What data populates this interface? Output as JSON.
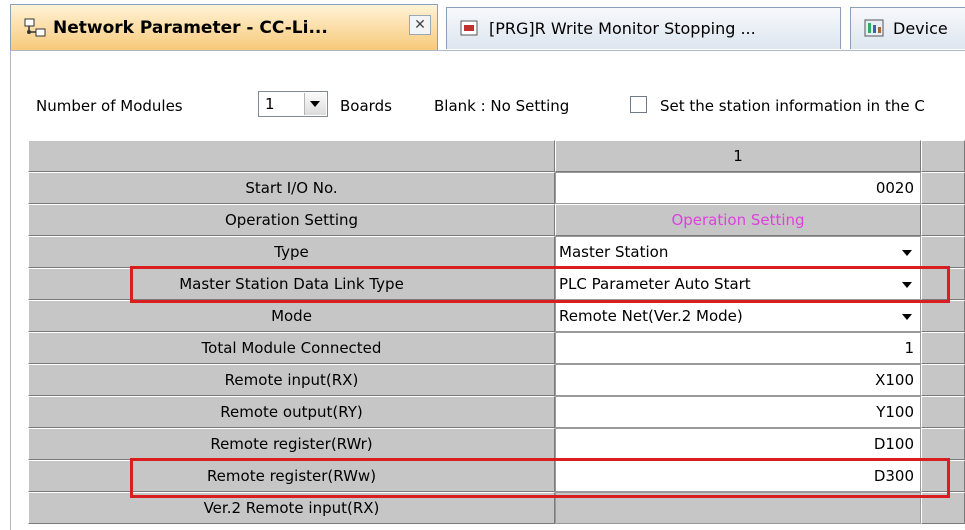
{
  "tabs": [
    {
      "label": "Network Parameter - CC-Li...",
      "icon": "network-parameter-icon",
      "active": true,
      "close": "✕"
    },
    {
      "label": "[PRG]R Write Monitor Stopping ...",
      "icon": "program-icon"
    },
    {
      "label": "Device",
      "icon": "device-icon"
    }
  ],
  "options": {
    "number_of_modules_label": "Number of Modules",
    "number_of_modules_value": "1",
    "boards_label": "Boards",
    "blank_label": "Blank : No Setting",
    "station_info_label": "Set the station information in the C"
  },
  "grid": {
    "column_header": "1",
    "rows": [
      {
        "label": "Start I/O No.",
        "value": "0020"
      },
      {
        "label": "Operation Setting",
        "value": "Operation Setting"
      },
      {
        "label": "Type",
        "value": "Master Station"
      },
      {
        "label": "Master Station Data Link Type",
        "value": "PLC Parameter Auto Start"
      },
      {
        "label": "Mode",
        "value": "Remote Net(Ver.2 Mode)"
      },
      {
        "label": "Total Module Connected",
        "value": "1"
      },
      {
        "label": "Remote input(RX)",
        "value": "X100"
      },
      {
        "label": "Remote output(RY)",
        "value": "Y100"
      },
      {
        "label": "Remote register(RWr)",
        "value": "D100"
      },
      {
        "label": "Remote register(RWw)",
        "value": "D300"
      },
      {
        "label": "Ver.2 Remote input(RX)",
        "value": ""
      }
    ]
  },
  "colors": {
    "highlight": "#d81e1e",
    "operation_setting_text": "#e040e0",
    "active_tab": "#f7c97a"
  }
}
